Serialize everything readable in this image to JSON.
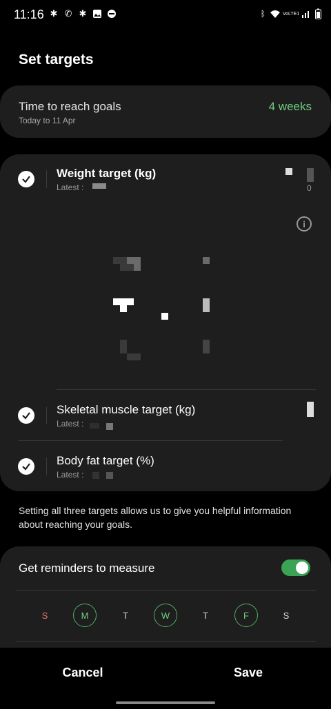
{
  "status_bar": {
    "time": "11:16",
    "network_label": "VoLTE1"
  },
  "page": {
    "title": "Set targets"
  },
  "time_card": {
    "label": "Time to reach goals",
    "sub": "Today to 11 Apr",
    "value": "4 weeks",
    "value_color": "#6fcf7f"
  },
  "targets": [
    {
      "label": "Weight target (kg)",
      "latest": "Latest :",
      "checked": true
    },
    {
      "label": "Skeletal muscle target (kg)",
      "latest": "Latest :",
      "checked": true
    },
    {
      "label": "Body fat target (%)",
      "latest": "Latest :",
      "checked": true
    }
  ],
  "weight_value": "0",
  "helper_text": "Setting all three targets allows us to give you helpful information about reaching your goals.",
  "reminders": {
    "label": "Get reminders to measure",
    "enabled": true,
    "days": [
      {
        "label": "S",
        "selected": false
      },
      {
        "label": "M",
        "selected": true
      },
      {
        "label": "T",
        "selected": false
      },
      {
        "label": "W",
        "selected": true
      },
      {
        "label": "T",
        "selected": false
      },
      {
        "label": "F",
        "selected": true
      },
      {
        "label": "S",
        "selected": false
      }
    ]
  },
  "actions": {
    "cancel": "Cancel",
    "save": "Save"
  },
  "colors": {
    "accent": "#6fcf7f",
    "toggle_on": "#3aa355",
    "sunday": "#e5756a",
    "card": "#1e1e1e"
  }
}
